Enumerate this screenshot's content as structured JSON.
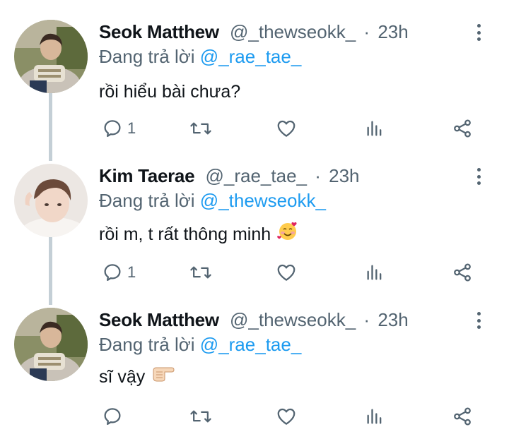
{
  "thread": {
    "tweets": [
      {
        "name": "Seok Matthew",
        "handle": "@_thewseokk_",
        "dot": "·",
        "time": "23h",
        "reply_prefix": "Đang trả lời",
        "reply_to": "@_rae_tae_",
        "text": "rồi hiểu bài chưa?",
        "emoji": "",
        "reply_count": "1",
        "avatar_colors": {
          "bg": "#7c8a5a",
          "skin": "#d8b79a",
          "hair": "#3a2a22"
        }
      },
      {
        "name": "Kim Taerae",
        "handle": "@_rae_tae_",
        "dot": "·",
        "time": "23h",
        "reply_prefix": "Đang trả lời",
        "reply_to": "@_thewseokk_",
        "text": "rồi m, t rất thông minh",
        "emoji": "smiling-face-with-hearts",
        "reply_count": "1",
        "avatar_colors": {
          "bg": "#e9e4e2",
          "skin": "#f1d7c8",
          "hair": "#6b4a3a"
        }
      },
      {
        "name": "Seok Matthew",
        "handle": "@_thewseokk_",
        "dot": "·",
        "time": "23h",
        "reply_prefix": "Đang trả lời",
        "reply_to": "@_rae_tae_",
        "text": "sĩ vậy",
        "emoji": "backhand-index-pointing-right",
        "reply_count": "",
        "avatar_colors": {
          "bg": "#7c8a5a",
          "skin": "#d8b79a",
          "hair": "#3a2a22"
        }
      }
    ]
  },
  "icons": {
    "action_icon_color": "#536471",
    "mention_color": "#1d9bf0",
    "thread_line_color": "#c4cfd6",
    "actions": [
      "reply-icon",
      "retweet-icon",
      "like-icon",
      "analytics-icon",
      "share-icon"
    ],
    "menu": "more-options-icon"
  }
}
